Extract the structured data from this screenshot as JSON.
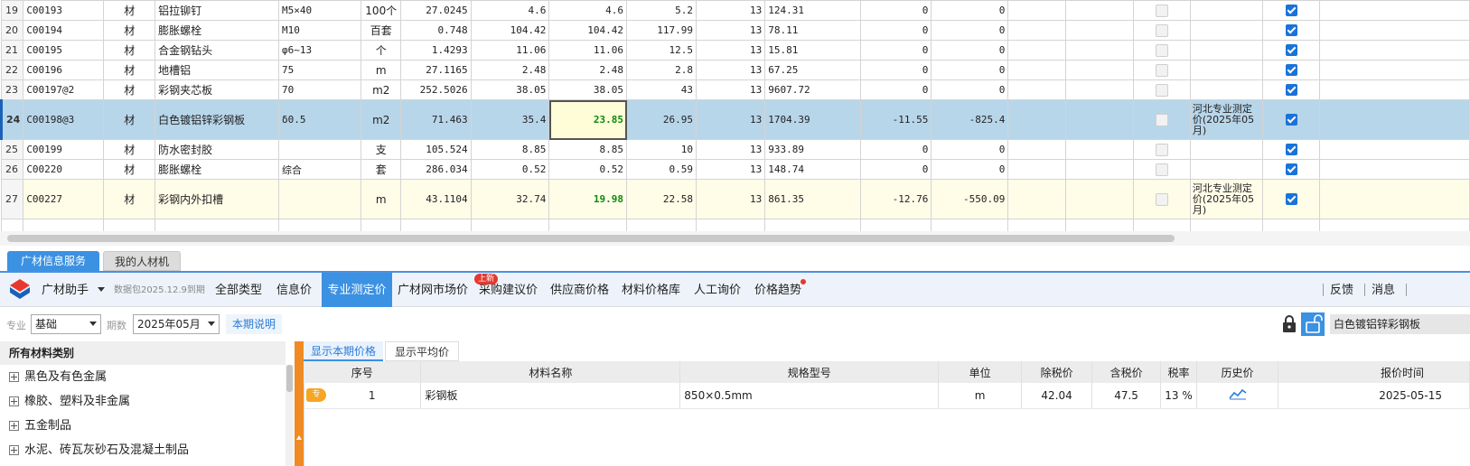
{
  "grid": {
    "rows": [
      {
        "rn": "19",
        "code": "C00193",
        "type": "材",
        "name": "铝拉铆钉",
        "spec": "M5×40",
        "unit": "100个",
        "qty": "27.0245",
        "p1": "4.6",
        "p2": "4.6",
        "p3": "5.2",
        "tax": "13",
        "amt": "124.31",
        "d1": "0",
        "d2": "0",
        "source": "",
        "style": ""
      },
      {
        "rn": "20",
        "code": "C00194",
        "type": "材",
        "name": "膨胀螺栓",
        "spec": "M10",
        "unit": "百套",
        "qty": "0.748",
        "p1": "104.42",
        "p2": "104.42",
        "p3": "117.99",
        "tax": "13",
        "amt": "78.11",
        "d1": "0",
        "d2": "0",
        "source": "",
        "style": ""
      },
      {
        "rn": "21",
        "code": "C00195",
        "type": "材",
        "name": "合金钢钻头",
        "spec": "φ6~13",
        "unit": "个",
        "qty": "1.4293",
        "p1": "11.06",
        "p2": "11.06",
        "p3": "12.5",
        "tax": "13",
        "amt": "15.81",
        "d1": "0",
        "d2": "0",
        "source": "",
        "style": ""
      },
      {
        "rn": "22",
        "code": "C00196",
        "type": "材",
        "name": "地槽铝",
        "spec": "75",
        "unit": "m",
        "qty": "27.1165",
        "p1": "2.48",
        "p2": "2.48",
        "p3": "2.8",
        "tax": "13",
        "amt": "67.25",
        "d1": "0",
        "d2": "0",
        "source": "",
        "style": ""
      },
      {
        "rn": "23",
        "code": "C00197@2",
        "type": "材",
        "name": "彩钢夹芯板",
        "spec": "70",
        "unit": "m2",
        "qty": "252.5026",
        "p1": "38.05",
        "p2": "38.05",
        "p3": "43",
        "tax": "13",
        "amt": "9607.72",
        "d1": "0",
        "d2": "0",
        "source": "",
        "style": ""
      },
      {
        "rn": "24",
        "code": "C00198@3",
        "type": "材",
        "name": "白色镀铝锌彩钢板",
        "spec": "δ0.5",
        "unit": "m2",
        "qty": "71.463",
        "p1": "35.4",
        "p2": "23.85",
        "p3": "26.95",
        "tax": "13",
        "amt": "1704.39",
        "d1": "-11.55",
        "d2": "-825.4",
        "source": "河北专业测定价(2025年05月)",
        "style": "sel"
      },
      {
        "rn": "25",
        "code": "C00199",
        "type": "材",
        "name": "防水密封胶",
        "spec": "",
        "unit": "支",
        "qty": "105.524",
        "p1": "8.85",
        "p2": "8.85",
        "p3": "10",
        "tax": "13",
        "amt": "933.89",
        "d1": "0",
        "d2": "0",
        "source": "",
        "style": ""
      },
      {
        "rn": "26",
        "code": "C00220",
        "type": "材",
        "name": "膨胀螺栓",
        "spec": "综合",
        "unit": "套",
        "qty": "286.034",
        "p1": "0.52",
        "p2": "0.52",
        "p3": "0.59",
        "tax": "13",
        "amt": "148.74",
        "d1": "0",
        "d2": "0",
        "source": "",
        "style": ""
      },
      {
        "rn": "27",
        "code": "C00227",
        "type": "材",
        "name": "彩钢内外扣槽",
        "spec": "",
        "unit": "m",
        "qty": "43.1104",
        "p1": "32.74",
        "p2": "19.98",
        "p3": "22.58",
        "tax": "13",
        "amt": "861.35",
        "d1": "-12.76",
        "d2": "-550.09",
        "source": "河北专业测定价(2025年05月)",
        "style": "yel"
      }
    ]
  },
  "panel_tabs": [
    "广材信息服务",
    "我的人材机"
  ],
  "toolbar": {
    "brand": "广材助手",
    "package": "数据包2025.12.9到期",
    "menu": [
      "全部类型",
      "信息价",
      "专业测定价",
      "广材网市场价",
      "采购建议价",
      "供应商价格",
      "材料价格库",
      "人工询价",
      "价格趋势"
    ],
    "new_badge": "上新",
    "right": [
      "反馈",
      "消息"
    ]
  },
  "filters": {
    "major_label": "专业",
    "major_value": "基础",
    "period_label": "期数",
    "period_value": "2025年05月",
    "note_link": "本期说明",
    "search_value": "白色镀铝锌彩钢板"
  },
  "tree": {
    "header": "所有材料类别",
    "items": [
      "黑色及有色金属",
      "橡胶、塑料及非金属",
      "五金制品",
      "水泥、砖瓦灰砂石及混凝土制品"
    ]
  },
  "results": {
    "tabs": [
      "显示本期价格",
      "显示平均价"
    ],
    "columns": [
      "序号",
      "材料名称",
      "规格型号",
      "单位",
      "除税价",
      "含税价",
      "税率",
      "历史价",
      "报价时间"
    ],
    "tag": "专",
    "rows": [
      {
        "no": "1",
        "name": "彩钢板",
        "spec": "850×0.5mm",
        "unit": "m",
        "price_ex": "42.04",
        "price_in": "47.5",
        "tax": "13 %",
        "date": "2025-05-15"
      }
    ]
  },
  "colors": {
    "accent": "#3b91e2",
    "selected_row": "#b8d6ea",
    "highlight_row": "#fffde8",
    "green_value": "#0a8a0a",
    "badge_red": "#e8372c"
  }
}
